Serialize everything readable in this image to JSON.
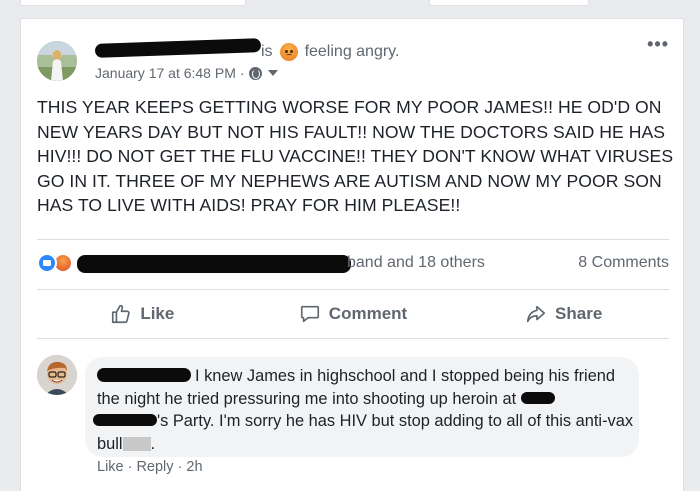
{
  "post": {
    "author_status_prefix": "is",
    "feeling_text": "feeling angry.",
    "date": "January 17 at 6:48 PM",
    "meta_sep": "·",
    "body": "THIS YEAR KEEPS GETTING WORSE FOR MY POOR JAMES!! HE OD'D ON NEW YEARS DAY BUT NOT HIS FAULT!! NOW THE DOCTORS SAID HE HAS HIV!!! DO NOT GET THE FLU VACCINE!! THEY DON'T KNOW WHAT VIRUSES GO IN IT. THREE OF MY NEPHEWS ARE AUTISM AND NOW MY POOR SON HAS TO LIVE WITH AIDS! PRAY FOR HIM PLEASE!!",
    "more_label": "•••"
  },
  "stats": {
    "reactors_text": "band and 18 others",
    "comments_count": "8 Comments"
  },
  "actions": {
    "like": "Like",
    "comment": "Comment",
    "share": "Share"
  },
  "comment": {
    "text_line1": "I knew James in highschool and I stopped being his friend the night he tried pressuring me into shooting up heroin at",
    "text_line2": "'s Party. I'm sorry he has HIV but stop adding to all of this anti-vax bull",
    "text_end": ".",
    "like": "Like",
    "reply": "Reply",
    "time": "2h",
    "sep": "·"
  },
  "colors": {
    "page_bg": "#e9ebee",
    "card_bg": "#ffffff",
    "secondary_text": "#606770",
    "like_blue": "#2d88ff",
    "bubble_bg": "#f2f3f5"
  },
  "icons": [
    "globe-icon",
    "caret-down-icon",
    "more-icon",
    "angry-emoji-icon",
    "like-reaction-icon",
    "angry-reaction-icon",
    "thumbs-up-icon",
    "comment-icon",
    "share-icon"
  ]
}
